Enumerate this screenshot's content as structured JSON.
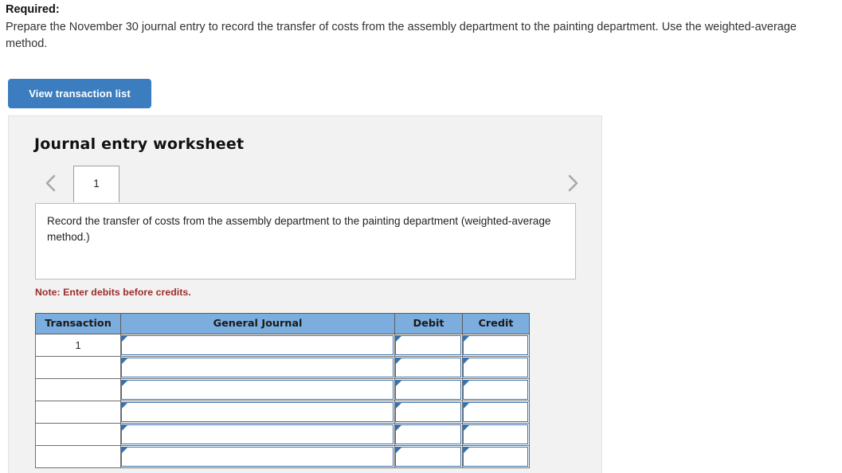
{
  "required": {
    "label": "Required:",
    "text": "Prepare the November 30 journal entry to record the transfer of costs from the assembly department to the painting department. Use the weighted-average method."
  },
  "toolbar": {
    "view_transaction_list_label": "View transaction list"
  },
  "worksheet": {
    "title": "Journal entry worksheet",
    "prev_icon": "chevron-left-icon",
    "next_icon": "chevron-right-icon",
    "tabs": [
      {
        "label": "1",
        "active": true
      }
    ],
    "description": "Record the transfer of costs from the assembly department to the painting department (weighted-average method.)",
    "note": "Note: Enter debits before credits."
  },
  "journal_table": {
    "columns": [
      "Transaction",
      "General Journal",
      "Debit",
      "Credit"
    ],
    "rows": [
      {
        "transaction": "1",
        "general_journal": "",
        "debit": "",
        "credit": ""
      },
      {
        "transaction": "",
        "general_journal": "",
        "debit": "",
        "credit": ""
      },
      {
        "transaction": "",
        "general_journal": "",
        "debit": "",
        "credit": ""
      },
      {
        "transaction": "",
        "general_journal": "",
        "debit": "",
        "credit": ""
      },
      {
        "transaction": "",
        "general_journal": "",
        "debit": "",
        "credit": ""
      },
      {
        "transaction": "",
        "general_journal": "",
        "debit": "",
        "credit": ""
      }
    ]
  },
  "colors": {
    "button_blue": "#3b7dbf",
    "header_blue": "#7badde",
    "field_border_blue": "#3a72ad",
    "note_red": "#9e2b2b",
    "panel_grey": "#f2f2f2"
  }
}
